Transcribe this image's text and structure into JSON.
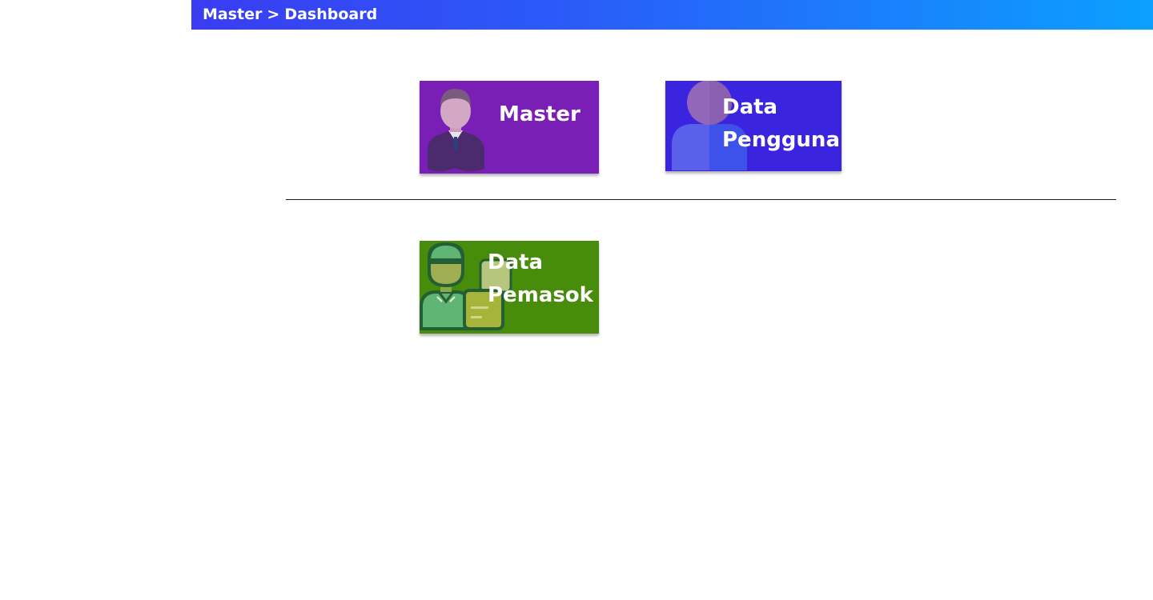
{
  "header": {
    "breadcrumb": [
      "Master",
      "Dashboard"
    ],
    "separator": ">"
  },
  "tiles": [
    {
      "label": "Master",
      "icon": "businessman-icon",
      "color": "#7a1fb5"
    },
    {
      "label": "Data Pengguna",
      "icon": "user-icon",
      "color": "#3a24e0"
    },
    {
      "label": "Data Pemasok",
      "icon": "delivery-person-icon",
      "color": "#478c0b"
    }
  ],
  "colors": {
    "header_gradient_start": "#3a3cf2",
    "header_gradient_end": "#0ba0ff"
  }
}
